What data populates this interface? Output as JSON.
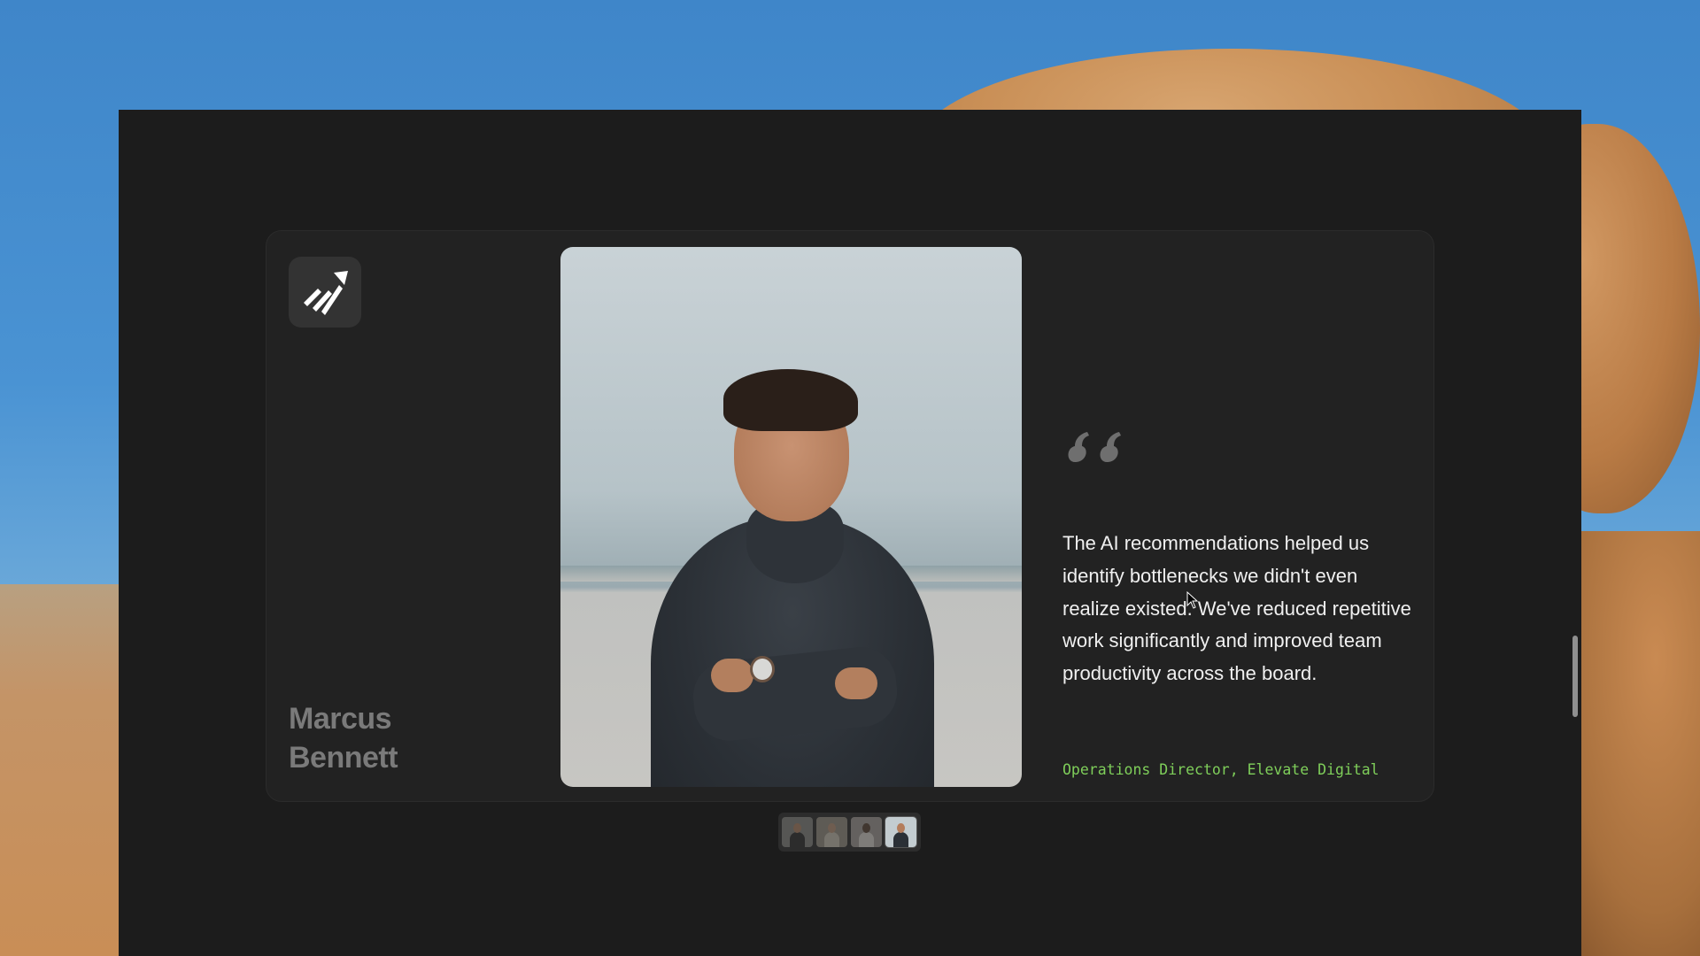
{
  "testimonial": {
    "name_line1": "Marcus",
    "name_line2": "Bennett",
    "quote": "The AI recommendations helped us identify bottlenecks we didn't even realize existed. We've reduced repetitive work significantly and improved team productivity across the board.",
    "role": "Operations Director, Elevate Digital",
    "photo_icon": "portrait-photo",
    "quote_icon": "quotation-mark-icon",
    "logo_icon": "rising-arrow-logo-icon"
  },
  "pager": {
    "thumbnails": [
      {
        "icon": "thumbnail-1",
        "active": false
      },
      {
        "icon": "thumbnail-2",
        "active": false
      },
      {
        "icon": "thumbnail-3",
        "active": false
      },
      {
        "icon": "thumbnail-4",
        "active": true
      }
    ],
    "selected_index": 3
  },
  "colors": {
    "window_bg": "#1c1c1c",
    "card_bg": "#222222",
    "name_text": "#7a7a7a",
    "quote_text": "#f0f0f0",
    "role_accent": "#7fcf5a",
    "quote_mark": "#6f6f6f"
  }
}
